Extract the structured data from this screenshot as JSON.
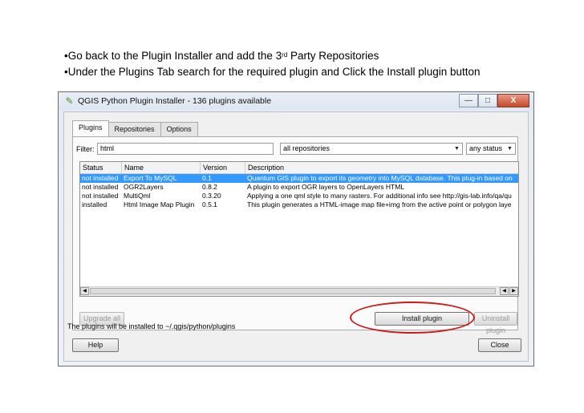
{
  "bullets": {
    "line1_prefix": "•Go back to the Plugin Installer and add the 3",
    "line1_sup": "rd",
    "line1_suffix": " Party Repositories",
    "line2": "•Under the Plugins Tab search for the required plugin and Click the Install plugin button"
  },
  "window": {
    "title": "QGIS Python Plugin Installer - 136 plugins available",
    "minimize": "—",
    "maximize": "□",
    "close": "X"
  },
  "tabs": [
    "Plugins",
    "Repositories",
    "Options"
  ],
  "filter": {
    "label": "Filter:",
    "value": "html",
    "repository": "all repositories",
    "status": "any status"
  },
  "table": {
    "columns": [
      "Status",
      "Name",
      "Version",
      "Description"
    ],
    "rows": [
      {
        "status": "not installed",
        "name": "Export To MySQL",
        "version": "0.1",
        "description": "Quantum GIS plugin to export its geometry into MySQL database. This plug-in based on"
      },
      {
        "status": "not installed",
        "name": "OGR2Layers",
        "version": "0.8.2",
        "description": "A plugin to export OGR layers to OpenLayers HTML"
      },
      {
        "status": "not installed",
        "name": "MultiQml",
        "version": "0.3.20",
        "description": "Applying a one qml style to many rasters. For additional info see http://gis-lab.info/qa/qu"
      },
      {
        "status": "installed",
        "name": "Html Image Map Plugin",
        "version": "0.5.1",
        "description": "This plugin generates a HTML-image map file+img from the active point or polygon laye"
      }
    ]
  },
  "buttons": {
    "upgrade_all": "Upgrade all",
    "install": "Install plugin",
    "uninstall": "Uninstall plugin",
    "help": "Help",
    "close": "Close"
  },
  "note": "The plugins will be installed to ~/.qgis/python/plugins",
  "colors": {
    "selection": "#3399ff",
    "highlight_ellipse": "#cc1b1b"
  }
}
